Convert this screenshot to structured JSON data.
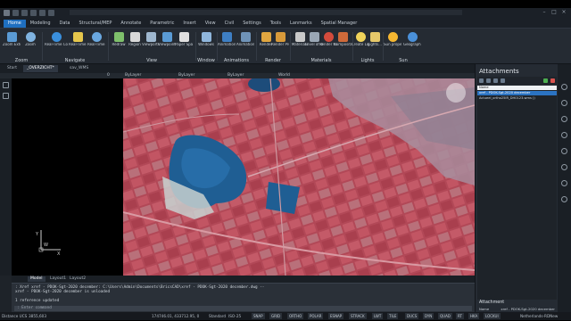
{
  "tabs": [
    "Home",
    "Modeling",
    "Data",
    "Structural/MEP",
    "Annotate",
    "Parametric",
    "Insert",
    "View",
    "Civil",
    "Settings",
    "Tools",
    "Lanmarks",
    "Spatial Manager"
  ],
  "active_tab": "Home",
  "ribbon": {
    "groups": [
      {
        "title": "Zoom",
        "buttons": [
          "Zoom Extents",
          "Zoom"
        ]
      },
      {
        "title": "Navigate",
        "buttons": [
          "Real-Time Constrained Sphere",
          "Real-Time Pan",
          "Real-Time Zoom"
        ]
      },
      {
        "title": "View",
        "buttons": [
          "Redraw",
          "Region",
          "Viewports",
          "Viewpoint",
          "Paper Space"
        ]
      },
      {
        "title": "Window",
        "buttons": [
          "Windows"
        ]
      },
      {
        "title": "Animations",
        "buttons": [
          "Animation Motion Path...",
          "Animation Editor"
        ]
      },
      {
        "title": "Render",
        "buttons": [
          "Render",
          "Render Presets"
        ]
      },
      {
        "title": "Materials",
        "buttons": [
          "Materials",
          "Level of detail",
          "Render Material",
          "Composition Material"
        ]
      },
      {
        "title": "Lights",
        "buttons": [
          "Create Lights",
          "Lights..."
        ]
      },
      {
        "title": "Sun",
        "buttons": [
          "Sun properties...",
          "Geographic Location..."
        ]
      }
    ]
  },
  "doc_tabs": [
    "Start",
    "_OVERZICHT*",
    "sav_WMS"
  ],
  "properties": {
    "layer": "0",
    "color": "ByLayer",
    "linetype": "ByLayer",
    "lineweight": "ByLayer",
    "ucs": "World"
  },
  "model_tabs": [
    "Model",
    "Layout1",
    "Layout2"
  ],
  "command_lines": [
    ": Xref xref - PDOK-Sgt-2020 december: C:\\Users\\Admin\\Documents\\BricsCAD\\xref - PDOK-Sgt-2020 december.dwg --",
    "  xref - PDOK-Sgt-2020 december is unloaded",
    "",
    "1 reference updated"
  ],
  "command_prompt": ": Enter command",
  "panel": {
    "title": "Attachments",
    "list_header": "Name",
    "rows": [
      {
        "label": "xref - PDOK-Sgt-2020 december",
        "selected": true
      },
      {
        "label": "Actueel_ortho25IR_DH0123.wms ()",
        "selected": false
      }
    ],
    "detail_title": "Attachment",
    "detail_name_label": "Name",
    "detail_name_value": "xref - PDOK-Sgt-2020 december"
  },
  "status": {
    "coords": "174746.01, 433712.95, 0",
    "style": "Standard",
    "scale": "ISO-25",
    "buttons": [
      "SNAP",
      "GRID",
      "ORTHO",
      "POLAR",
      "ESNAP",
      "STRACK",
      "LWT",
      "TILE",
      "DUCS",
      "DYN",
      "QUAD",
      "RT",
      "HKA",
      "LOCKUI"
    ],
    "unit_prefix": "Distance UCS",
    "workspace": "Netherlands-RDNew",
    "left_value": "3855,603"
  },
  "colors": {
    "accent": "#1f6fbf",
    "background": "#1e2329",
    "satellite_land": "#b24857",
    "water": "#1f5e93"
  }
}
